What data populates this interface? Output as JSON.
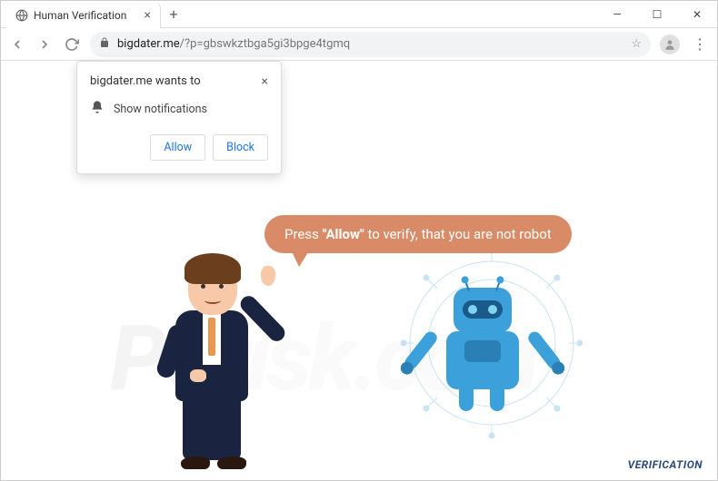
{
  "window": {
    "tab_title": "Human Verification",
    "minimize": "—",
    "maximize": "☐",
    "close": "✕"
  },
  "nav": {
    "url_host": "bigdater.me",
    "url_path": "/?p=gbswkztbga5gi3bpge4tgmq"
  },
  "permission": {
    "title": "bigdater.me wants to",
    "message": "Show notifications",
    "allow": "Allow",
    "block": "Block"
  },
  "page": {
    "bubble_pre": "Press ",
    "bubble_bold": "\"Allow\"",
    "bubble_post": " to verify, that you are not robot",
    "footer": "VERIFICATION",
    "watermark_a": "PC",
    "watermark_b": "risk.com"
  }
}
